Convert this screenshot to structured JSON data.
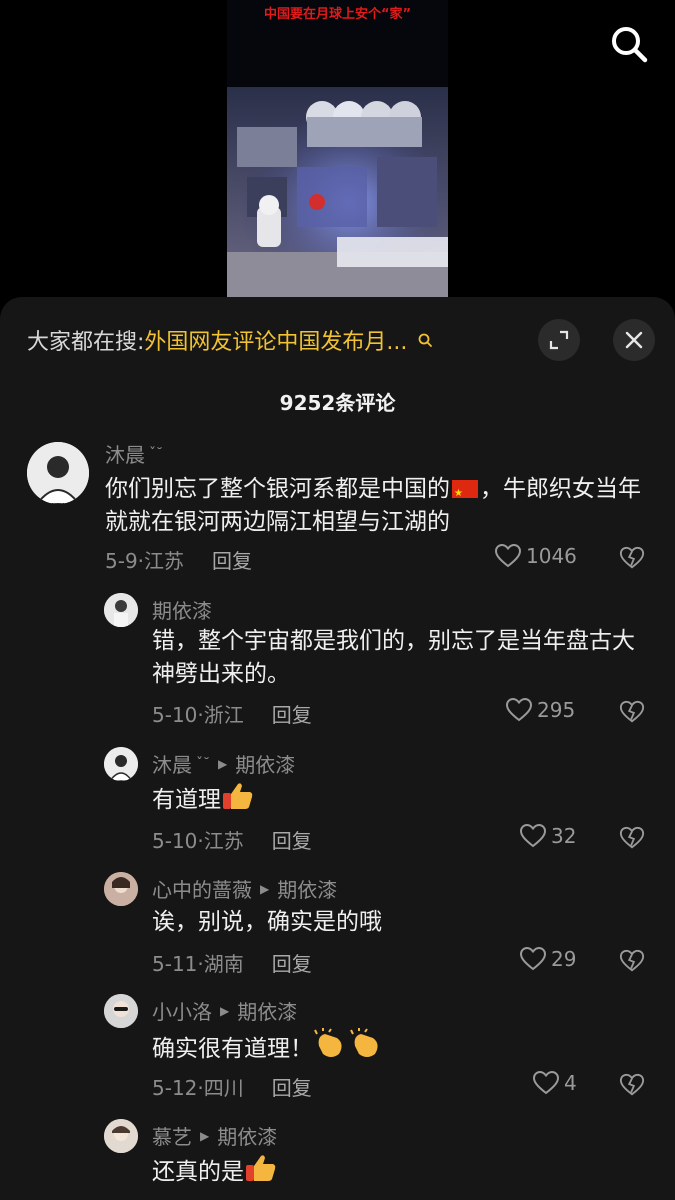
{
  "video": {
    "caption": "中国要在月球上安个“家”"
  },
  "header": {
    "hot_prefix": "大家都在搜:",
    "hot_term": "外国网友评论中国发布月...",
    "search_icon": "search-icon",
    "expand_icon": "expand-icon",
    "close_icon": "close-icon"
  },
  "comment_count": "9252条评论",
  "comments": [
    {
      "user": "沐晨",
      "user_suffix": "ˇ˘",
      "text_a": "你们别忘了整个银河系都是中国的",
      "text_b": "，牛郎织女当年就就在银河两边隔江相望与江湖的",
      "date_loc": "5-9·江苏",
      "reply_label": "回复",
      "likes": "1046"
    },
    {
      "user": "期依漆",
      "text": "错，整个宇宙都是我们的，别忘了是当年盘古大神劈出来的。",
      "date_loc": "5-10·浙江",
      "reply_label": "回复",
      "likes": "295"
    },
    {
      "user": "沐晨",
      "user_suffix": "ˇ˘",
      "reply_to": "期依漆",
      "text": "有道理",
      "date_loc": "5-10·江苏",
      "reply_label": "回复",
      "likes": "32"
    },
    {
      "user": "心中的蔷薇",
      "reply_to": "期依漆",
      "text": "诶，别说，确实是的哦",
      "date_loc": "5-11·湖南",
      "reply_label": "回复",
      "likes": "29"
    },
    {
      "user": "小小洛",
      "reply_to": "期依漆",
      "text": "确实很有道理！",
      "date_loc": "5-12·四川",
      "reply_label": "回复",
      "likes": "4"
    },
    {
      "user": "慕艺",
      "reply_to": "期依漆",
      "text": "还真的是"
    }
  ],
  "colors": {
    "sheet_bg": "#161616",
    "hot_term": "#f1c232",
    "muted": "#8c8c8c"
  }
}
